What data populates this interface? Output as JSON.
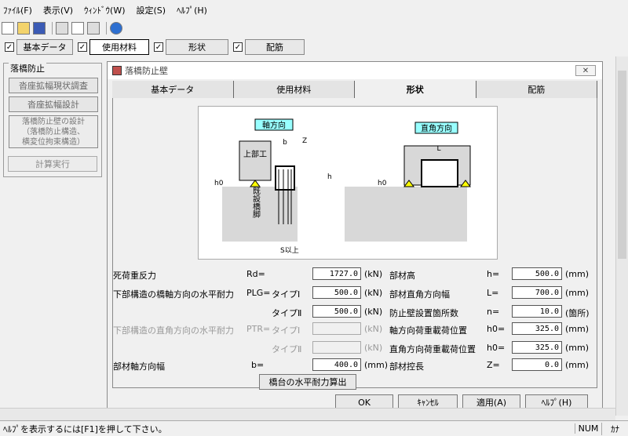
{
  "menu": [
    "ﾌｧｲﾙ(F)",
    "表示(V)",
    "ｳｨﾝﾄﾞｳ(W)",
    "設定(S)",
    "ﾍﾙﾌﾟ(H)"
  ],
  "toptabs": [
    {
      "label": "基本データ",
      "checked": true
    },
    {
      "label": "使用材料",
      "checked": true,
      "active": true
    },
    {
      "label": "形状",
      "checked": true
    },
    {
      "label": "配筋",
      "checked": false
    }
  ],
  "sidebar": {
    "title": "落橋防止",
    "btn1": "沓座拡幅現状調査",
    "btn2": "沓座拡幅設計",
    "multi": [
      "落橋防止壁の設計",
      "（落橋防止構造、",
      "横変位拘束構造）"
    ],
    "calc": "計算実行"
  },
  "dialog": {
    "title": "落橋防止壁",
    "close": "✕",
    "tabs": [
      "基本データ",
      "使用材料",
      "形状",
      "配筋"
    ],
    "figure": {
      "axis_label": "軸方向",
      "perp_label": "直角方向",
      "upper": "上部工",
      "pier": "既設橋脚",
      "b": "b",
      "z": "Z",
      "h": "h",
      "h0": "h0",
      "s": "S以上",
      "L": "L"
    },
    "left": {
      "rd_label": "死荷重反力",
      "rd_sym": "Rd=",
      "rd_val": "1727.0",
      "rd_unit": "(kN)",
      "plg_label": "下部構造の橋軸方向の水平耐力",
      "plg_sym": "PLG=",
      "type1": "タイプⅠ",
      "type2": "タイプⅡ",
      "plg1": "500.0",
      "plg2": "500.0",
      "plg_unit": "(kN)",
      "ptr_label": "下部構造の直角方向の水平耐力",
      "ptr_sym": "PTR=",
      "ptr1": "",
      "ptr2": "",
      "ptr_unit": "(kN)",
      "b_label": "部材軸方向幅",
      "b_sym": "b=",
      "b_val": "400.0",
      "b_unit": "(mm)",
      "calc_btn": "橋台の水平耐力算出"
    },
    "right": {
      "h_label": "部材高",
      "h_sym": "h=",
      "h_val": "500.0",
      "h_unit": "(mm)",
      "L_label": "部材直角方向幅",
      "L_sym": "L=",
      "L_val": "700.0",
      "L_unit": "(mm)",
      "n_label": "防止壁設置箇所数",
      "n_sym": "n=",
      "n_val": "10.0",
      "n_unit": "(箇所)",
      "h0a_label": "軸方向荷重載荷位置",
      "h0a_sym": "h0=",
      "h0a_val": "325.0",
      "h0a_unit": "(mm)",
      "h0b_label": "直角方向荷重載荷位置",
      "h0b_sym": "h0=",
      "h0b_val": "325.0",
      "h0b_unit": "(mm)",
      "z_label": "部材控長",
      "z_sym": "Z=",
      "z_val": "0.0",
      "z_unit": "(mm)"
    },
    "buttons": {
      "ok": "OK",
      "cancel": "ｷｬﾝｾﾙ",
      "apply": "適用(A)",
      "help": "ﾍﾙﾌﾟ(H)"
    }
  },
  "status": {
    "message": "ﾍﾙﾌﾟを表示するには[F1]を押して下さい。",
    "num": "NUM",
    "kana": "ｶﾅ"
  }
}
